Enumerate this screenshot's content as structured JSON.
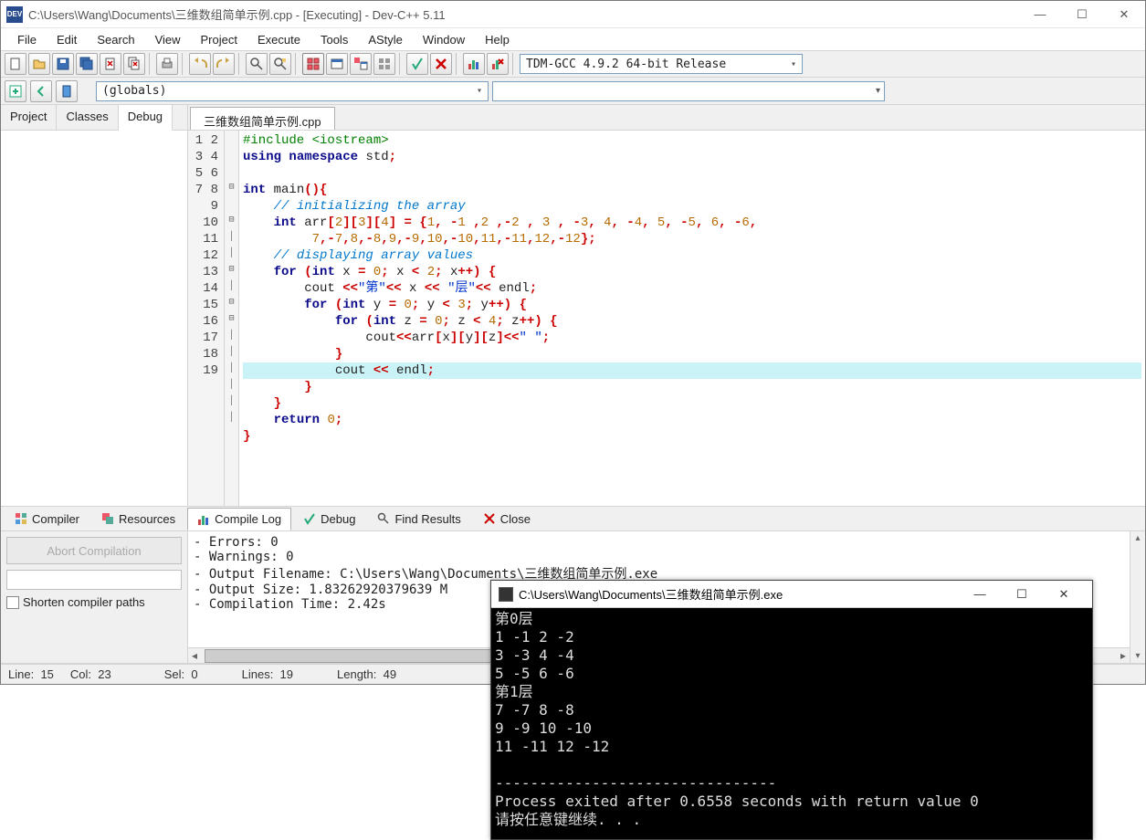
{
  "window": {
    "title": "C:\\Users\\Wang\\Documents\\三维数组简单示例.cpp - [Executing] - Dev-C++ 5.11"
  },
  "menu": [
    "File",
    "Edit",
    "Search",
    "View",
    "Project",
    "Execute",
    "Tools",
    "AStyle",
    "Window",
    "Help"
  ],
  "compiler_combo": "TDM-GCC 4.9.2 64-bit Release",
  "globals_combo": "(globals)",
  "left_tabs": {
    "project": "Project",
    "classes": "Classes",
    "debug": "Debug"
  },
  "file_tab": "三维数组简单示例.cpp",
  "code_lines": 19,
  "bottom_tabs": {
    "compiler": "Compiler",
    "resources": "Resources",
    "compile_log": "Compile Log",
    "debug": "Debug",
    "find_results": "Find Results",
    "close": "Close"
  },
  "abort_label": "Abort Compilation",
  "shorten_label": "Shorten compiler paths",
  "log": {
    "errors": "- Errors: 0",
    "warnings": "- Warnings: 0",
    "outfile": "- Output Filename: C:\\Users\\Wang\\Documents\\三维数组简单示例.exe",
    "outsize": "- Output Size: 1.83262920379639 M",
    "comptime": "- Compilation Time: 2.42s"
  },
  "status": {
    "line_lbl": "Line:",
    "line_v": "15",
    "col_lbl": "Col:",
    "col_v": "23",
    "sel_lbl": "Sel:",
    "sel_v": "0",
    "lines_lbl": "Lines:",
    "lines_v": "19",
    "length_lbl": "Length:",
    "length_v": "49"
  },
  "console": {
    "title": "C:\\Users\\Wang\\Documents\\三维数组简单示例.exe",
    "body": "第0层\n1 -1 2 -2\n3 -3 4 -4\n5 -5 6 -6\n第1层\n7 -7 8 -8\n9 -9 10 -10\n11 -11 12 -12\n\n--------------------------------\nProcess exited after 0.6558 seconds with return value 0\n请按任意键继续. . ."
  }
}
